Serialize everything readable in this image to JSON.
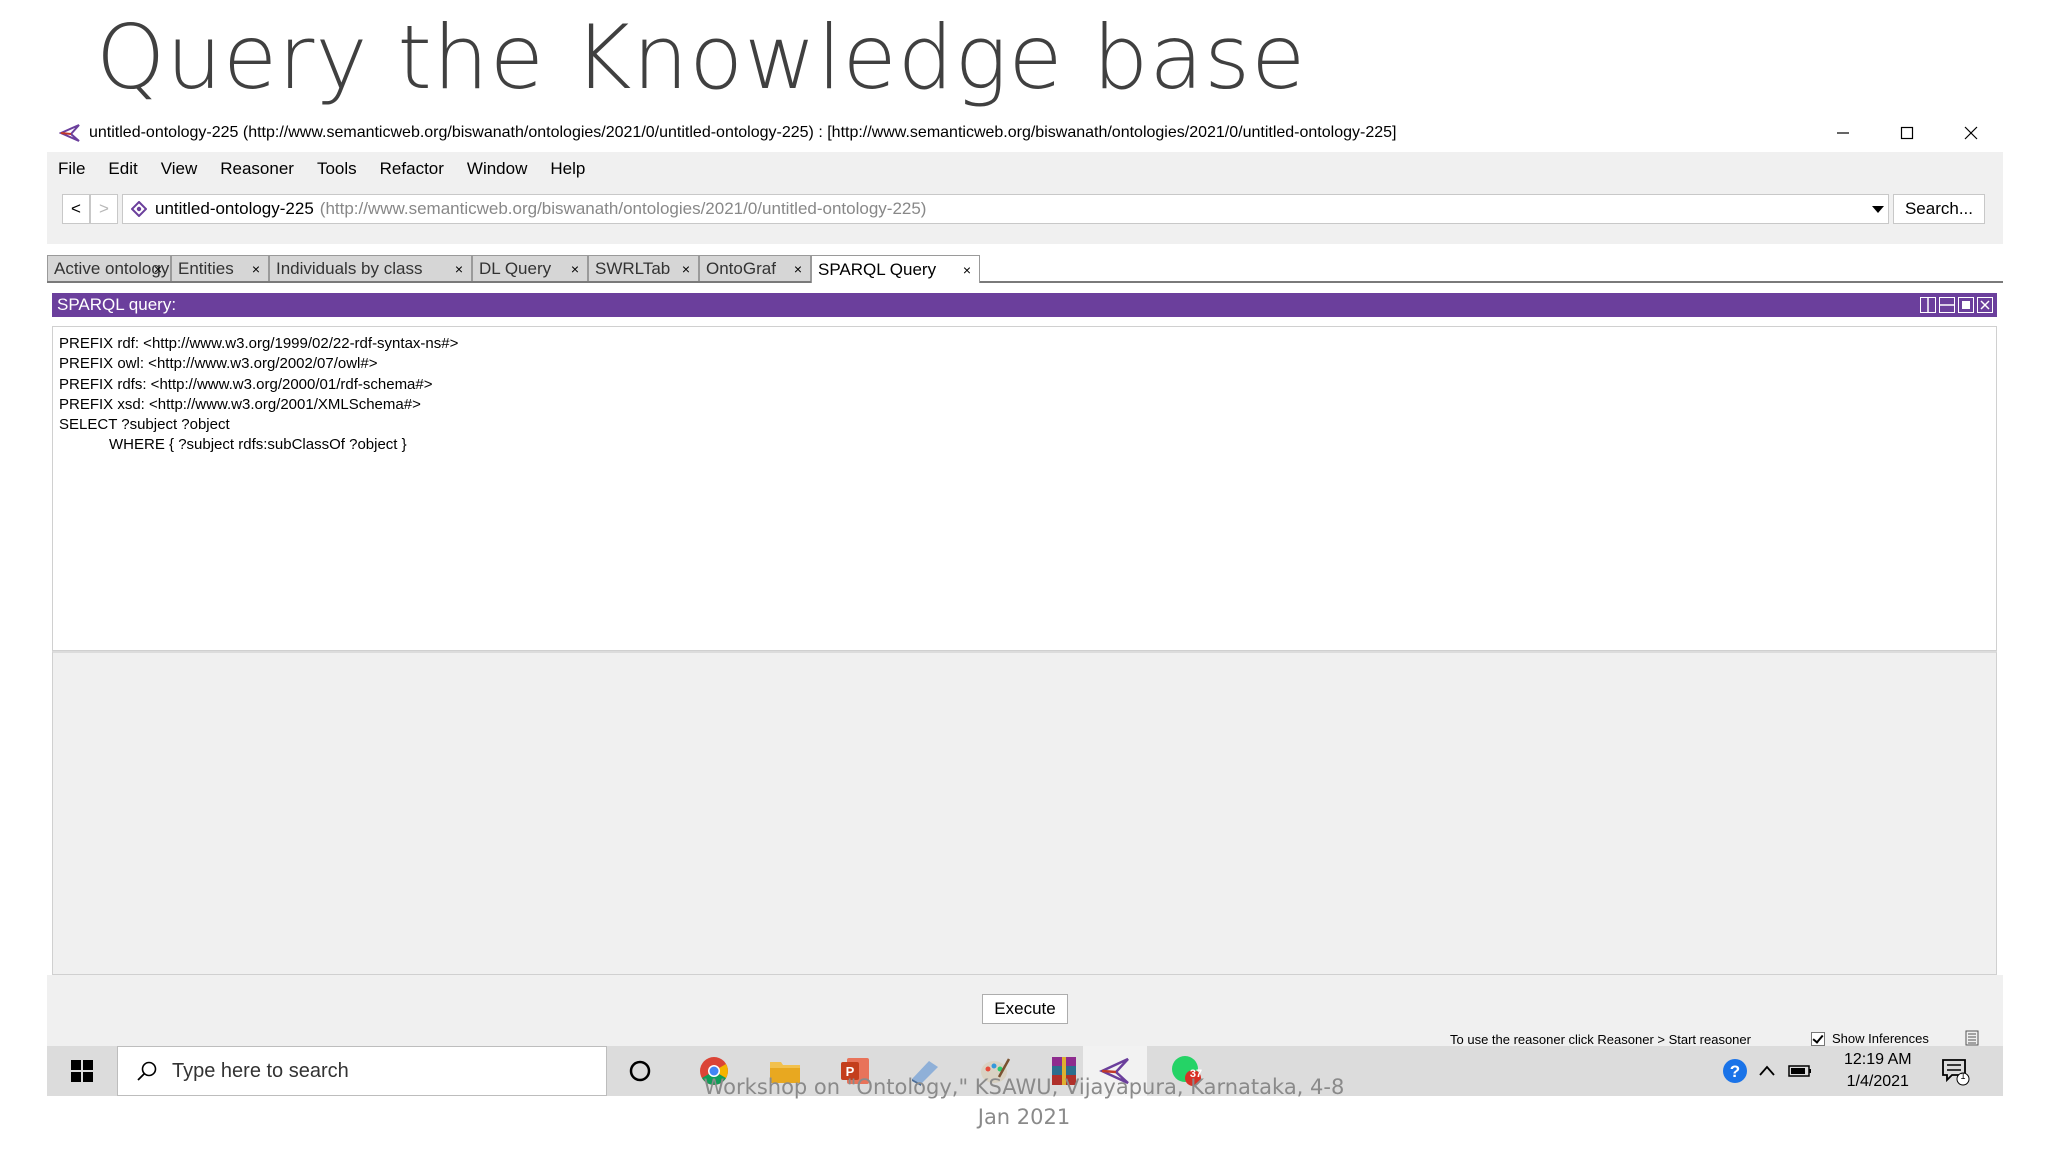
{
  "slide": {
    "title": "Query the Knowledge base",
    "footer_line1": "Workshop on \"Ontology,\" KSAWU, Vijayapura, Karnataka, 4-8",
    "footer_line2": "Jan 2021"
  },
  "window": {
    "title": "untitled-ontology-225 (http://www.semanticweb.org/biswanath/ontologies/2021/0/untitled-ontology-225)  : [http://www.semanticweb.org/biswanath/ontologies/2021/0/untitled-ontology-225]",
    "controls": [
      "minimize",
      "maximize",
      "close"
    ]
  },
  "menu": [
    "File",
    "Edit",
    "View",
    "Reasoner",
    "Tools",
    "Refactor",
    "Window",
    "Help"
  ],
  "nav": {
    "back": "<",
    "forward": ">",
    "ontology_name": "untitled-ontology-225",
    "ontology_iri": "(http://www.semanticweb.org/biswanath/ontologies/2021/0/untitled-ontology-225)",
    "search_label": "Search..."
  },
  "tabs": [
    {
      "label": "Active ontology",
      "close": "×",
      "active": false
    },
    {
      "label": "Entities",
      "close": "×",
      "active": false
    },
    {
      "label": "Individuals by class",
      "close": "×",
      "active": false
    },
    {
      "label": "DL Query",
      "close": "×",
      "active": false
    },
    {
      "label": "SWRLTab",
      "close": "×",
      "active": false
    },
    {
      "label": "OntoGraf",
      "close": "×",
      "active": false
    },
    {
      "label": "SPARQL Query",
      "close": "×",
      "active": true
    }
  ],
  "panel": {
    "title": "SPARQL query:",
    "accent": "#6b3f9c",
    "query": "PREFIX rdf: <http://www.w3.org/1999/02/22-rdf-syntax-ns#>\nPREFIX owl: <http://www.w3.org/2002/07/owl#>\nPREFIX rdfs: <http://www.w3.org/2000/01/rdf-schema#>\nPREFIX xsd: <http://www.w3.org/2001/XMLSchema#>\nSELECT ?subject ?object\n\tWHERE { ?subject rdfs:subClassOf ?object }"
  },
  "bottom": {
    "execute_label": "Execute",
    "reasoner_hint": "To use the reasoner click Reasoner > Start reasoner",
    "show_inferences_label": "Show Inferences",
    "show_inferences_checked": true
  },
  "taskbar": {
    "search_placeholder": "Type here to search",
    "apps": [
      "cortana-icon",
      "chrome-icon",
      "file-explorer-icon",
      "powerpoint-icon",
      "app-icon",
      "paint-icon",
      "winrar-icon",
      "protege-icon",
      "whatsapp-icon"
    ],
    "whatsapp_badge": "37",
    "time": "12:19 AM",
    "date": "1/4/2021",
    "notification_count": "1"
  }
}
